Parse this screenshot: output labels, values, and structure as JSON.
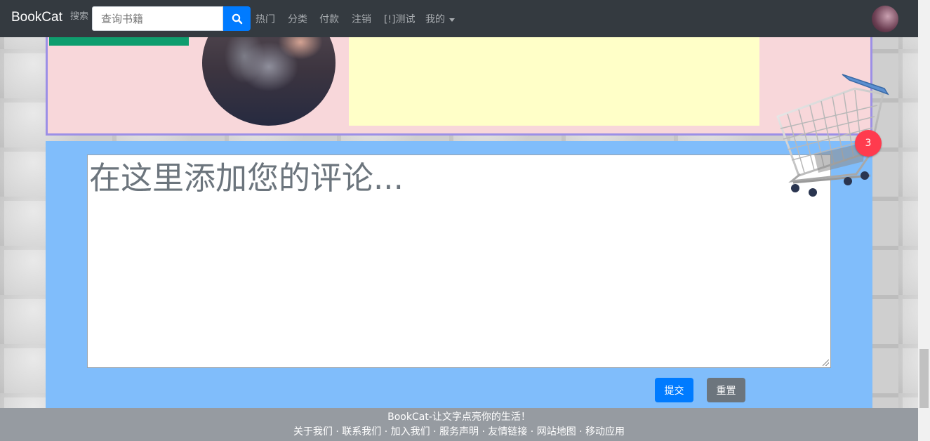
{
  "navbar": {
    "brand": "BookCat",
    "search_label": "搜索",
    "search_placeholder": "查询书籍",
    "items": [
      {
        "label": "热门"
      },
      {
        "label": "分类"
      },
      {
        "label": "付款"
      },
      {
        "label": "注销"
      },
      {
        "label": "[!]测试"
      },
      {
        "label": "我的"
      }
    ]
  },
  "comment": {
    "placeholder": "在这里添加您的评论...",
    "submit_label": "提交",
    "reset_label": "重置"
  },
  "cart": {
    "count": "3"
  },
  "footer": {
    "tagline": "BookCat-让文字点亮你的生活！",
    "links": "关于我们 · 联系我们 · 加入我们 · 服务声明 · 友情链接 · 网站地图 · 移动应用"
  },
  "colors": {
    "nav_bg": "#343a40",
    "primary": "#007bff",
    "secondary": "#6c757d",
    "comment_bg": "#80bdfb",
    "pink_panel": "#f8d7da",
    "yellow_box": "#ffffc8",
    "badge": "#ff3b4e",
    "footer_bg": "#969ba1"
  }
}
